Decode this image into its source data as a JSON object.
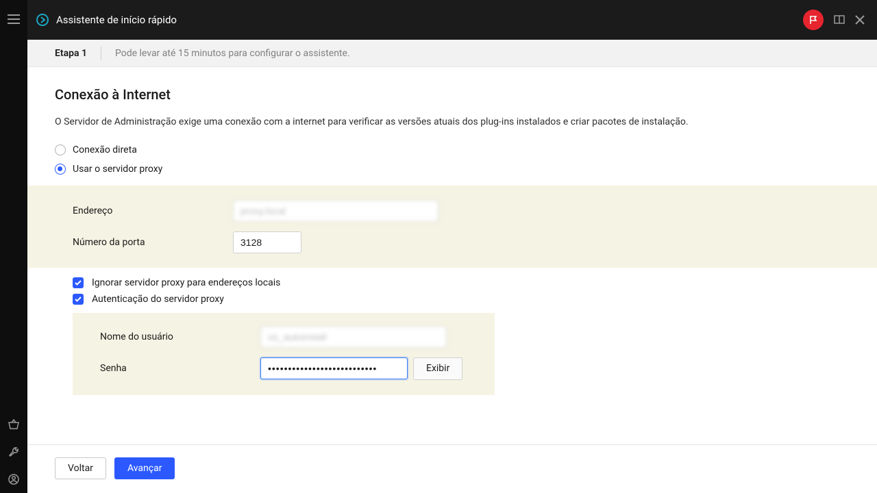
{
  "header": {
    "title": "Assistente de início rápido",
    "icons": {
      "brand": "brand-circle-arrow",
      "flag": "flag",
      "bookmark": "bookmark",
      "close": "close"
    }
  },
  "sidebar": {
    "top_icon": "hamburger",
    "bottom_icons": [
      "basket",
      "wrench",
      "profile"
    ]
  },
  "stepbar": {
    "step_label": "Etapa 1",
    "info": "Pode levar até 15 minutos para configurar o assistente."
  },
  "page": {
    "title": "Conexão à Internet",
    "description": "O Servidor de Administração exige uma conexão com a internet para verificar as versões atuais dos plug-ins instalados e criar pacotes de instalação.",
    "radios": {
      "direct": "Conexão direta",
      "proxy": "Usar o servidor proxy",
      "selected": "proxy"
    },
    "fields": {
      "address_label": "Endereço",
      "address_value": "proxy.local",
      "port_label": "Número da porta",
      "port_value": "3128",
      "bypass_label": "Ignorar servidor proxy para endereços locais",
      "auth_label": "Autenticação do servidor proxy",
      "user_label": "Nome do usuário",
      "user_value": "os_autoinstall",
      "password_label": "Senha",
      "password_value": "•••••••••••••••••••••••••••",
      "show_button": "Exibir"
    }
  },
  "footer": {
    "back": "Voltar",
    "next": "Avançar"
  },
  "colors": {
    "accent": "#2b59ff",
    "danger": "#e6252f",
    "panel": "#f5f3e3"
  }
}
